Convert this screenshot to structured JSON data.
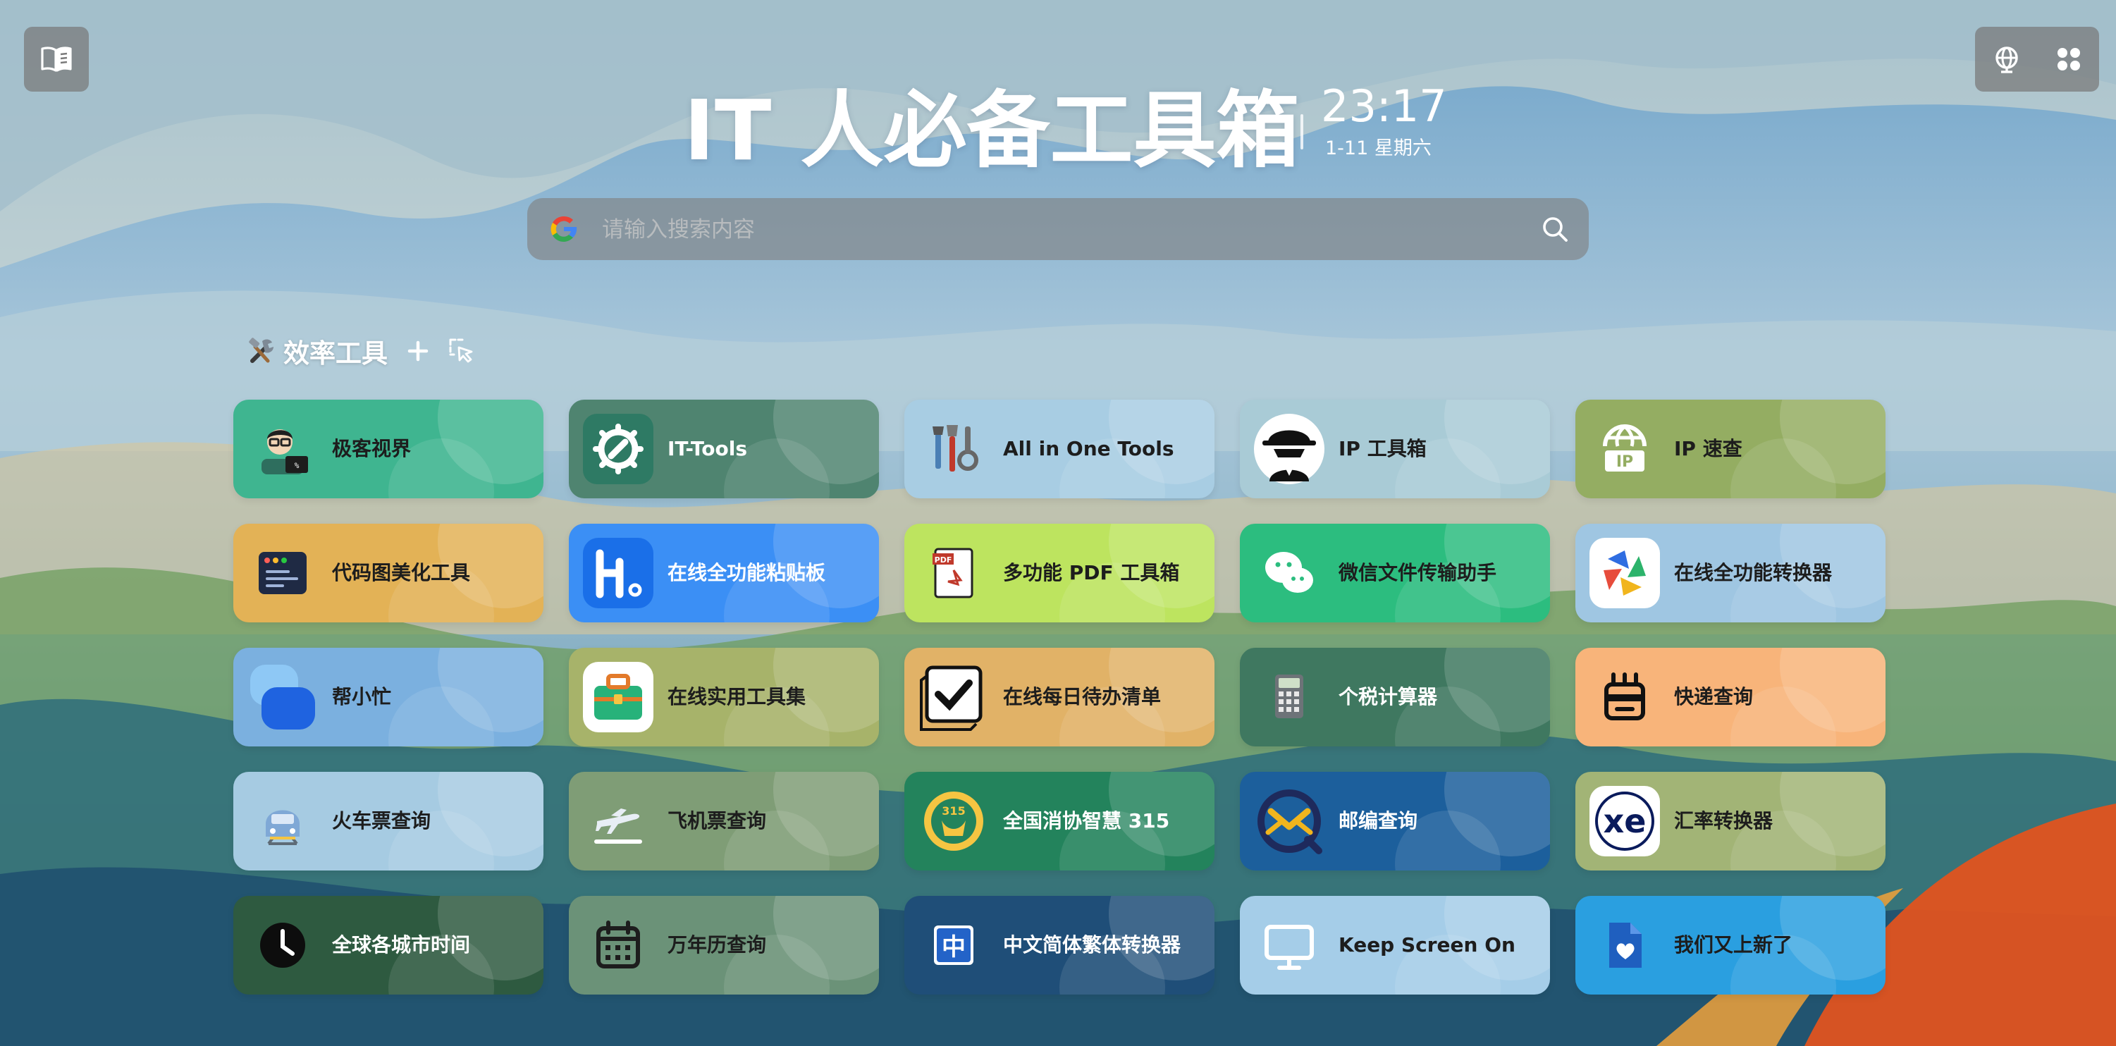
{
  "page": {
    "title": "IT 人必备工具箱"
  },
  "clock": {
    "time": "23:17",
    "date": "1-11 星期六"
  },
  "search": {
    "placeholder": "请输入搜索内容"
  },
  "section": {
    "title": "效率工具",
    "icons": [
      "tools-icon",
      "plus-icon",
      "select-icon"
    ]
  },
  "colors": {
    "accent": "#2f7cf6",
    "text_dark": "#1d1d1d"
  },
  "tools": [
    {
      "label": "极客视界",
      "color": "#3fb590",
      "text": "dark",
      "icon": "geek-avatar-icon"
    },
    {
      "label": "IT-Tools",
      "color": "#4f8470",
      "text": "light",
      "icon": "wrench-gear-icon"
    },
    {
      "label": "All in One Tools",
      "color": "#a8cde3",
      "text": "dark",
      "icon": "tools-set-icon"
    },
    {
      "label": "IP 工具箱",
      "color": "#a9cbd6",
      "text": "dark",
      "icon": "spy-icon"
    },
    {
      "label": "IP 速查",
      "color": "#94ad62",
      "text": "dark",
      "icon": "globe-ip-icon"
    },
    {
      "label": "代码图美化工具",
      "color": "#e3b256",
      "text": "dark",
      "icon": "code-window-icon"
    },
    {
      "label": "在线全功能粘贴板",
      "color": "#3b8ff5",
      "text": "light",
      "icon": "clipboard-h-icon"
    },
    {
      "label": "多功能 PDF 工具箱",
      "color": "#bde45f",
      "text": "dark",
      "icon": "pdf-icon"
    },
    {
      "label": "微信文件传输助手",
      "color": "#2cbd7f",
      "text": "dark",
      "icon": "wechat-icon"
    },
    {
      "label": "在线全功能转换器",
      "color": "#9fc6e2",
      "text": "dark",
      "icon": "convert-logo-icon"
    },
    {
      "label": "帮小忙",
      "color": "#7bb0df",
      "text": "dark",
      "icon": "helper-icon"
    },
    {
      "label": "在线实用工具集",
      "color": "#a7b36a",
      "text": "dark",
      "icon": "toolbox-icon"
    },
    {
      "label": "在线每日待办清单",
      "color": "#e1b267",
      "text": "dark",
      "icon": "checkbox-icon"
    },
    {
      "label": "个税计算器",
      "color": "#3f7860",
      "text": "light",
      "icon": "calculator-icon"
    },
    {
      "label": "快递查询",
      "color": "#f8b47a",
      "text": "dark",
      "icon": "delivery-box-icon"
    },
    {
      "label": "火车票查询",
      "color": "#a6cbe2",
      "text": "dark",
      "icon": "train-icon"
    },
    {
      "label": "飞机票查询",
      "color": "#7f9d76",
      "text": "dark",
      "icon": "airplane-icon"
    },
    {
      "label": "全国消协智慧 315",
      "color": "#23835c",
      "text": "light",
      "icon": "consumer-315-icon"
    },
    {
      "label": "邮编查询",
      "color": "#1c5f9c",
      "text": "light",
      "icon": "postcode-icon"
    },
    {
      "label": "汇率转换器",
      "color": "#a2b476",
      "text": "dark",
      "icon": "xe-icon"
    },
    {
      "label": "全球各城市时间",
      "color": "#2e5a40",
      "text": "light",
      "icon": "clock-icon"
    },
    {
      "label": "万年历查询",
      "color": "#6b9278",
      "text": "dark",
      "icon": "calendar-icon"
    },
    {
      "label": "中文简体繁体转换器",
      "color": "#1f4e78",
      "text": "light",
      "icon": "zhong-icon"
    },
    {
      "label": "Keep Screen On",
      "color": "#a5cde8",
      "text": "dark",
      "icon": "monitor-icon"
    },
    {
      "label": "我们又上新了",
      "color": "#2a9fe0",
      "text": "dark",
      "icon": "file-heart-icon"
    }
  ]
}
